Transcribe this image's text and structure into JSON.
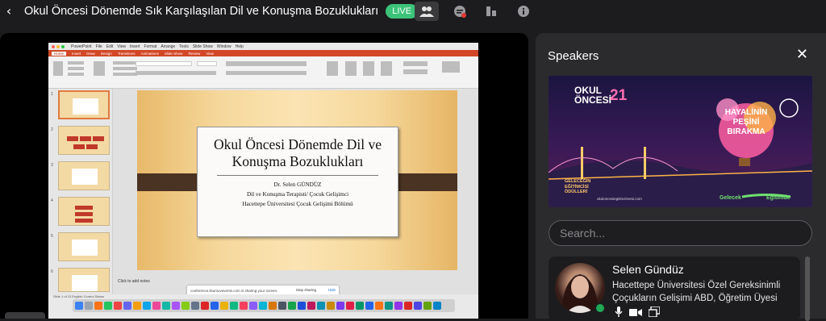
{
  "header": {
    "back_label": "‹",
    "title": "Okul Öncesi Dönemde Sık Karşılaşılan Dil ve Konuşma Bozuklukları",
    "live_badge": "LIVE"
  },
  "shared_screen": {
    "app_menu": [
      "PowerPoint",
      "File",
      "Edit",
      "View",
      "Insert",
      "Format",
      "Arrange",
      "Tools",
      "Slide Show",
      "Window",
      "Help"
    ],
    "ribbon_tabs": [
      "Home",
      "Insert",
      "Draw",
      "Design",
      "Transitions",
      "Animations",
      "Slide Show",
      "Review",
      "View"
    ],
    "slide": {
      "title": "Okul Öncesi Dönemde Dil ve Konuşma Bozuklukları",
      "author": "Dr. Selen GÜNDÜZ",
      "role": "Dil ve Konuşma Terapisti/ Çocuk Gelişimci",
      "affiliation": "Hacettepe Üniversitesi Çocuk Gelişimi Bölümü"
    },
    "thumb_numbers": [
      "1",
      "2",
      "3",
      "4",
      "5",
      "6"
    ],
    "notes_placeholder": "Click to add notes",
    "share_notice": "conference.ilsumovevents.com is sharing your screen.",
    "stop_sharing": "Stop sharing",
    "hide": "Hide",
    "status_text": "Slide 1 of 13   English   Control Status"
  },
  "speakers_panel": {
    "title": "Speakers",
    "close_label": "✕",
    "search_placeholder": "Search...",
    "banner": {
      "event_name_1": "OKUL",
      "event_name_2": "ÖNCESİ",
      "event_year": "21",
      "slogan_1": "HAYALİNİN",
      "slogan_2": "PEŞİNİ",
      "slogan_3": "BIRAKMA",
      "award_1": "GELECEĞİN",
      "award_2": "EĞİTİMCİSİ",
      "award_3": "ÖDÜLLERİ",
      "sponsor": "Gelecek",
      "sponsor2": "Eğitimde",
      "website": "okuloncesiegitimzirvesi.com"
    },
    "speakers": [
      {
        "name": "Selen Gündüz",
        "role": "Hacettepe Üniversitesi Özel Gereksinimli Çoçukların Gelişimi ABD, Öğretim Üyesi"
      }
    ]
  },
  "colors": {
    "live": "#3cc37a",
    "powerpoint": "#d24726",
    "presence": "#1fa855"
  }
}
